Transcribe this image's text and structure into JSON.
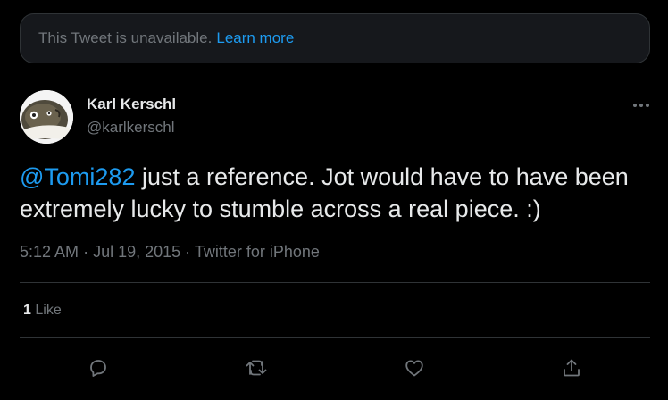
{
  "banner": {
    "message": "This Tweet is unavailable.",
    "link": "Learn more"
  },
  "author": {
    "name": "Karl Kerschl",
    "handle": "@karlkerschl"
  },
  "tweet": {
    "mention": "@Tomi282",
    "text": " just a reference. Jot would have to have been extremely lucky to stumble across a real piece. :)"
  },
  "meta": {
    "time": "5:12 AM",
    "separator": "·",
    "date": "Jul 19, 2015",
    "source": "Twitter for iPhone"
  },
  "stats": {
    "likes_count": "1",
    "likes_label": "Like"
  },
  "icons": {
    "more": "more-horizontal-icon",
    "reply": "reply-icon",
    "retweet": "retweet-icon",
    "like": "like-icon",
    "share": "share-icon"
  },
  "colors": {
    "background": "#000000",
    "accent": "#1d9bf0",
    "text_primary": "#e7e9ea",
    "text_secondary": "#71767b",
    "border": "#2f3336"
  }
}
